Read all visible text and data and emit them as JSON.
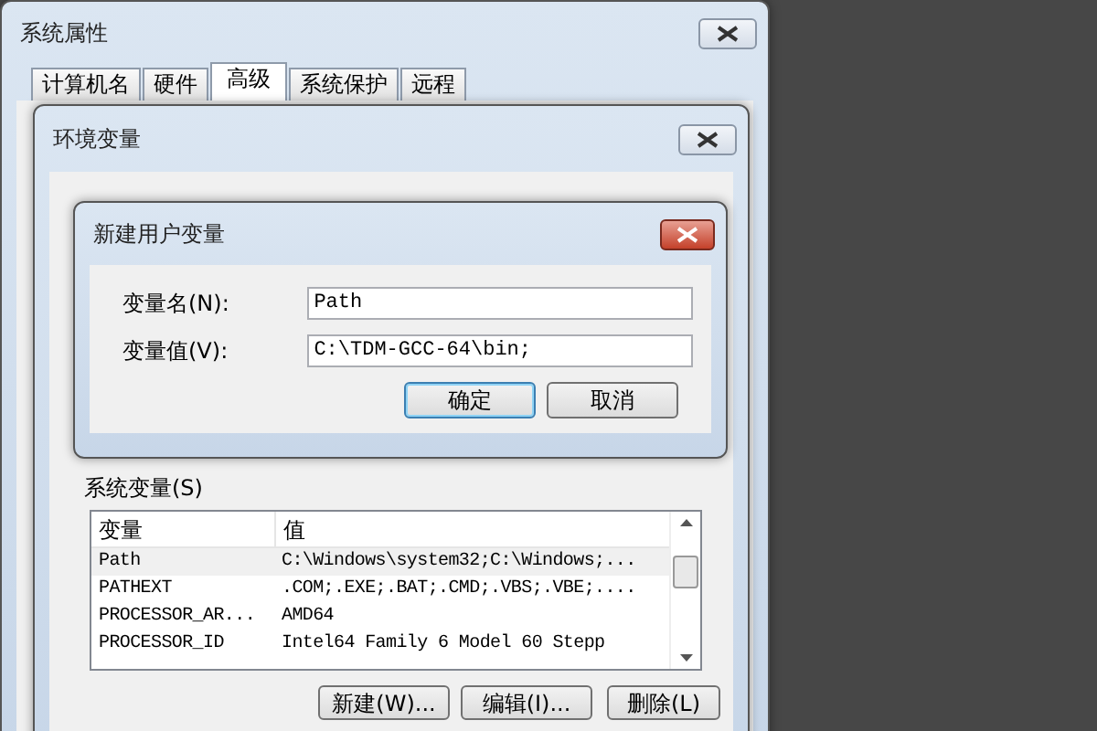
{
  "system_properties": {
    "title": "系统属性",
    "tabs": [
      {
        "label": "计算机名",
        "selected": false
      },
      {
        "label": "硬件",
        "selected": false
      },
      {
        "label": "高级",
        "selected": true
      },
      {
        "label": "系统保护",
        "selected": false
      },
      {
        "label": "远程",
        "selected": false
      }
    ]
  },
  "environment_variables": {
    "title": "环境变量",
    "system_variables": {
      "label": "系统变量(S)",
      "columns": [
        "变量",
        "值"
      ],
      "rows": [
        {
          "name": "Path",
          "value": "C:\\Windows\\system32;C:\\Windows;...",
          "selected": true
        },
        {
          "name": "PATHEXT",
          "value": ".COM;.EXE;.BAT;.CMD;.VBS;.VBE;....",
          "selected": false
        },
        {
          "name": "PROCESSOR_AR...",
          "value": "AMD64",
          "selected": false
        },
        {
          "name": "PROCESSOR_ID",
          "value": "Intel64 Family 6 Model 60 Stepp",
          "selected": false
        }
      ],
      "buttons": [
        "新建(W)...",
        "编辑(I)...",
        "删除(L)"
      ]
    }
  },
  "new_user_variable": {
    "title": "新建用户变量",
    "fields": [
      {
        "label": "变量名(N):",
        "value": "Path"
      },
      {
        "label": "变量值(V):",
        "value": "C:\\TDM-GCC-64\\bin;"
      }
    ],
    "buttons": [
      {
        "label": "确定",
        "default": true
      },
      {
        "label": "取消",
        "default": false
      }
    ]
  }
}
